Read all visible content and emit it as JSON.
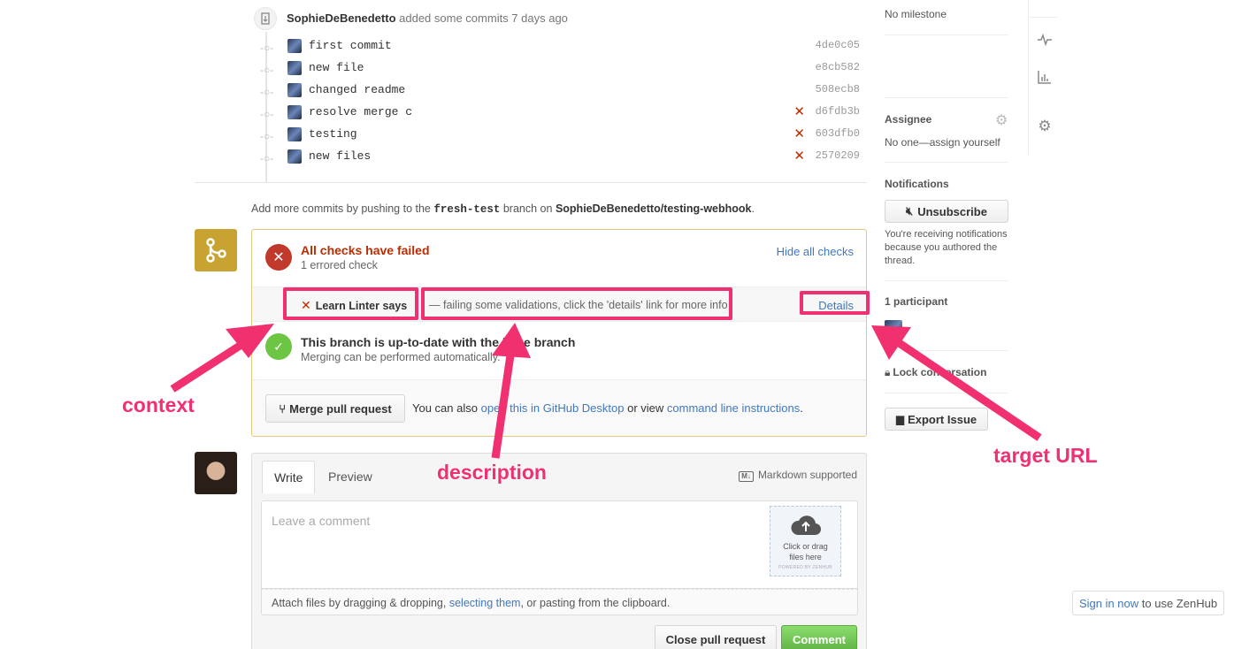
{
  "timeline": {
    "event_user": "SophieDeBenedetto",
    "event_action": "added some commits 7 days ago",
    "commits": [
      {
        "message": "first commit",
        "sha": "4de0c05",
        "failed": false
      },
      {
        "message": "new file",
        "sha": "e8cb582",
        "failed": false
      },
      {
        "message": "changed readme",
        "sha": "508ecb8",
        "failed": false
      },
      {
        "message": "resolve merge c",
        "sha": "d6fdb3b",
        "failed": true
      },
      {
        "message": "testing",
        "sha": "603dfb0",
        "failed": true
      },
      {
        "message": "new files",
        "sha": "2570209",
        "failed": true
      }
    ],
    "push_note_pre": "Add more commits by pushing to the",
    "push_branch": "fresh-test",
    "push_note_mid": "branch on",
    "push_repo": "SophieDeBenedetto/testing-webhook",
    "push_note_end": "."
  },
  "merge": {
    "fail_title": "All checks have failed",
    "fail_sub": "1 errored check",
    "hide_checks": "Hide all checks",
    "check_context": "Learn Linter says",
    "check_desc": "— failing some validations, click the 'details' link for more info",
    "check_details": "Details",
    "ok_title": "This branch is up-to-date with the base branch",
    "ok_sub": "Merging can be performed automatically.",
    "merge_button": "Merge pull request",
    "alt_pre": "You can also",
    "alt_link1": "open this in GitHub Desktop",
    "alt_mid": "or view",
    "alt_link2": "command line instructions",
    "alt_end": "."
  },
  "comment": {
    "tab_write": "Write",
    "tab_preview": "Preview",
    "markdown": "Markdown supported",
    "placeholder": "Leave a comment",
    "drop_text": "Click or drag files here",
    "drop_powered": "POWERED BY ZENHUB",
    "attach_pre": "Attach files by dragging & dropping,",
    "attach_link": "selecting them",
    "attach_end": ", or pasting from the clipboard.",
    "close_button": "Close pull request",
    "comment_button": "Comment"
  },
  "sidebar": {
    "milestone": "No milestone",
    "assignee_title": "Assignee",
    "assignee_text": "No one—assign yourself",
    "notifications_title": "Notifications",
    "unsubscribe": "Unsubscribe",
    "notif_reason": "You're receiving notifications because you authored the thread.",
    "participants": "1 participant",
    "lock": "Lock conversation",
    "export": "Export Issue"
  },
  "zenhub": {
    "signin_link": "Sign in now",
    "signin_rest": "to use ZenHub"
  },
  "annotations": {
    "context": "context",
    "description": "description",
    "target_url": "target URL"
  },
  "colors": {
    "annotation": "#f0306f",
    "fail": "#bd2c00",
    "success": "#6cc644",
    "link": "#4078c0",
    "merge_pending": "#c9a332"
  }
}
